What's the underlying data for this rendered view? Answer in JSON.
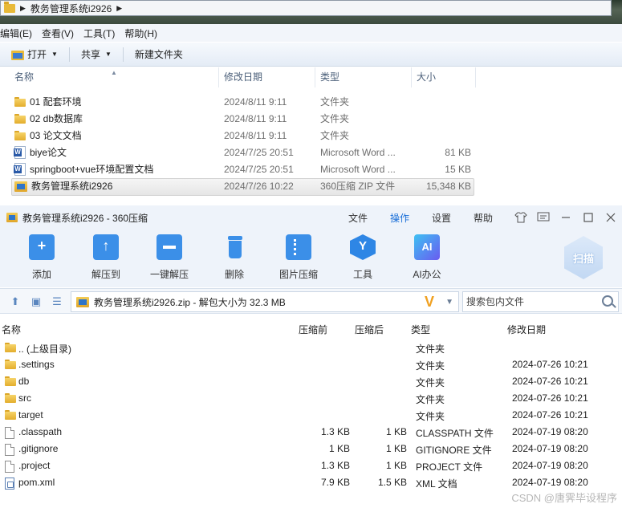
{
  "explorer": {
    "breadcrumb": "教务管理系统i2926",
    "menu": [
      "编辑(E)",
      "查看(V)",
      "工具(T)",
      "帮助(H)"
    ],
    "toolbar": {
      "open": "打开",
      "share": "共享",
      "new_folder": "新建文件夹"
    },
    "columns": {
      "name": "名称",
      "date": "修改日期",
      "type": "类型",
      "size": "大小"
    },
    "files": [
      {
        "icon": "folder-icon",
        "name": "01 配套环境",
        "date": "2024/8/11 9:11",
        "type": "文件夹",
        "size": ""
      },
      {
        "icon": "folder-icon",
        "name": "02 db数据库",
        "date": "2024/8/11 9:11",
        "type": "文件夹",
        "size": ""
      },
      {
        "icon": "folder-icon",
        "name": "03 论文文档",
        "date": "2024/8/11 9:11",
        "type": "文件夹",
        "size": ""
      },
      {
        "icon": "word-doc-icon",
        "name": "biye论文",
        "date": "2024/7/25 20:51",
        "type": "Microsoft Word ...",
        "size": "81 KB"
      },
      {
        "icon": "word-doc-icon",
        "name": "springboot+vue环境配置文档",
        "date": "2024/7/25 20:51",
        "type": "Microsoft Word ...",
        "size": "15 KB"
      },
      {
        "icon": "zip-archive-icon",
        "name": "教务管理系统i2926",
        "date": "2024/7/26 10:22",
        "type": "360压缩 ZIP 文件",
        "size": "15,348 KB"
      }
    ]
  },
  "zip": {
    "title": "教务管理系统i2926 - 360压缩",
    "menu": {
      "file": "文件",
      "operate": "操作",
      "settings": "设置",
      "help": "帮助"
    },
    "ribbon": {
      "add": "添加",
      "extract_to": "解压到",
      "one_click": "一键解压",
      "delete": "删除",
      "image_compress": "图片压缩",
      "tools": "工具",
      "ai_office": "AI办公",
      "scan": "扫描"
    },
    "path_text": "教务管理系统i2926.zip - 解包大小为 32.3 MB",
    "search_placeholder": "搜索包内文件",
    "columns": {
      "name": "名称",
      "compressed": "压缩前",
      "packed": "压缩后",
      "type": "类型",
      "date": "修改日期"
    },
    "entries": [
      {
        "icon": "folder-icon",
        "name": ".. (上级目录)",
        "before": "",
        "after": "",
        "type": "文件夹",
        "date": ""
      },
      {
        "icon": "folder-icon",
        "name": ".settings",
        "before": "",
        "after": "",
        "type": "文件夹",
        "date": "2024-07-26 10:21"
      },
      {
        "icon": "folder-icon",
        "name": "db",
        "before": "",
        "after": "",
        "type": "文件夹",
        "date": "2024-07-26 10:21"
      },
      {
        "icon": "folder-icon",
        "name": "src",
        "before": "",
        "after": "",
        "type": "文件夹",
        "date": "2024-07-26 10:21"
      },
      {
        "icon": "folder-icon",
        "name": "target",
        "before": "",
        "after": "",
        "type": "文件夹",
        "date": "2024-07-26 10:21"
      },
      {
        "icon": "file-icon",
        "name": ".classpath",
        "before": "1.3 KB",
        "after": "1 KB",
        "type": "CLASSPATH 文件",
        "date": "2024-07-19 08:20"
      },
      {
        "icon": "file-icon",
        "name": ".gitignore",
        "before": "1 KB",
        "after": "1 KB",
        "type": "GITIGNORE 文件",
        "date": "2024-07-19 08:20"
      },
      {
        "icon": "file-icon",
        "name": ".project",
        "before": "1.3 KB",
        "after": "1 KB",
        "type": "PROJECT 文件",
        "date": "2024-07-19 08:20"
      },
      {
        "icon": "xml-file-icon",
        "name": "pom.xml",
        "before": "7.9 KB",
        "after": "1.5 KB",
        "type": "XML 文档",
        "date": "2024-07-19 08:20"
      }
    ]
  },
  "watermark": "CSDN @唐霁毕设程序"
}
